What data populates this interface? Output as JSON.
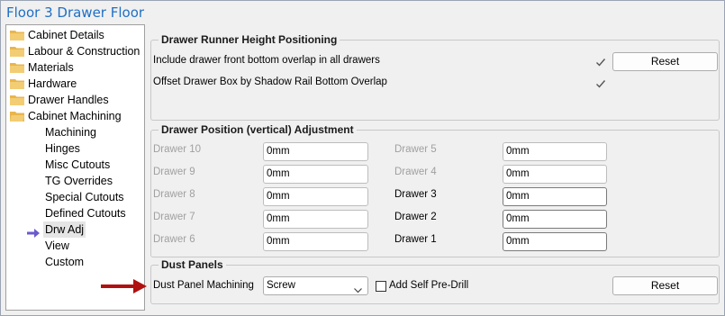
{
  "window": {
    "title": "Floor 3 Drawer Floor"
  },
  "tree": {
    "folders": [
      {
        "label": "Cabinet Details"
      },
      {
        "label": "Labour & Construction"
      },
      {
        "label": "Materials"
      },
      {
        "label": "Hardware"
      },
      {
        "label": "Drawer Handles"
      },
      {
        "label": "Cabinet Machining"
      }
    ],
    "children": [
      {
        "label": "Machining"
      },
      {
        "label": "Hinges"
      },
      {
        "label": "Misc Cutouts"
      },
      {
        "label": "TG Overrides"
      },
      {
        "label": "Special Cutouts"
      },
      {
        "label": "Defined Cutouts"
      },
      {
        "label": "Drw Adj"
      },
      {
        "label": "View"
      },
      {
        "label": "Custom"
      }
    ],
    "selected": "Drw Adj"
  },
  "runner_group": {
    "title": "Drawer Runner Height Positioning",
    "rows": [
      {
        "label": "Include drawer front bottom overlap in all drawers",
        "checked": true
      },
      {
        "label": "Offset Drawer Box by Shadow Rail Bottom Overlap",
        "checked": true
      }
    ],
    "reset_label": "Reset"
  },
  "position_group": {
    "title": "Drawer Position (vertical) Adjustment",
    "left": [
      {
        "label": "Drawer 10",
        "value": "0mm",
        "enabled": false
      },
      {
        "label": "Drawer 9",
        "value": "0mm",
        "enabled": false
      },
      {
        "label": "Drawer 8",
        "value": "0mm",
        "enabled": false
      },
      {
        "label": "Drawer 7",
        "value": "0mm",
        "enabled": false
      },
      {
        "label": "Drawer 6",
        "value": "0mm",
        "enabled": false
      }
    ],
    "right": [
      {
        "label": "Drawer 5",
        "value": "0mm",
        "enabled": false
      },
      {
        "label": "Drawer 4",
        "value": "0mm",
        "enabled": false
      },
      {
        "label": "Drawer 3",
        "value": "0mm",
        "enabled": true
      },
      {
        "label": "Drawer 2",
        "value": "0mm",
        "enabled": true
      },
      {
        "label": "Drawer 1",
        "value": "0mm",
        "enabled": true
      }
    ]
  },
  "dust_group": {
    "title": "Dust Panels",
    "machining_label": "Dust Panel Machining",
    "machining_value": "Screw",
    "predrill_label": "Add Self Pre-Drill",
    "predrill_checked": false,
    "reset_label": "Reset"
  },
  "colors": {
    "title": "#1f6fc5",
    "selection_arrow": "#6a5acd",
    "annotation_arrow": "#b01010"
  }
}
